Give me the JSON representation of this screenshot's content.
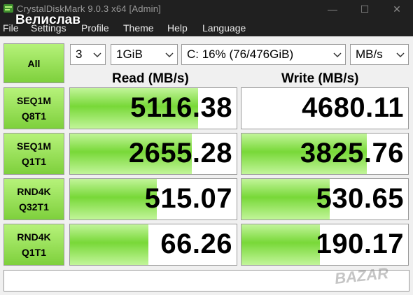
{
  "window": {
    "title": "CrystalDiskMark 9.0.3 x64 [Admin]",
    "overlay_text": "Велислав",
    "minimize": "—",
    "maximize": "☐",
    "close": "✕"
  },
  "menu": [
    "File",
    "Settings",
    "Profile",
    "Theme",
    "Help",
    "Language"
  ],
  "controls": {
    "all_label": "All",
    "count": "3",
    "size": "1GiB",
    "drive": "C: 16% (76/476GiB)",
    "unit": "MB/s"
  },
  "headers": {
    "read": "Read (MB/s)",
    "write": "Write (MB/s)"
  },
  "tests": [
    {
      "line1": "SEQ1M",
      "line2": "Q8T1",
      "read": "5116.38",
      "write": "4680.11",
      "read_fill": 0.77,
      "write_fill": 0.0
    },
    {
      "line1": "SEQ1M",
      "line2": "Q1T1",
      "read": "2655.28",
      "write": "3825.76",
      "read_fill": 0.73,
      "write_fill": 0.75
    },
    {
      "line1": "RND4K",
      "line2": "Q32T1",
      "read": "515.07",
      "write": "530.65",
      "read_fill": 0.52,
      "write_fill": 0.53
    },
    {
      "line1": "RND4K",
      "line2": "Q1T1",
      "read": "66.26",
      "write": "190.17",
      "read_fill": 0.47,
      "write_fill": 0.47
    }
  ],
  "colors": {
    "green_light": "#c2f59a",
    "green_dark": "#78d838",
    "titlebar": "#202020"
  },
  "watermark": "BAZAR"
}
